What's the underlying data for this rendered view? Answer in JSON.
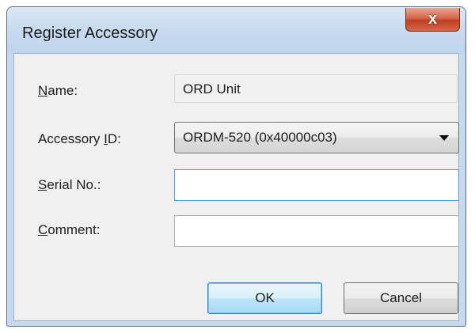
{
  "window": {
    "title": "Register Accessory",
    "close_glyph": "x"
  },
  "form": {
    "name": {
      "label_key": "N",
      "label_rest": "ame:",
      "value": "ORD Unit"
    },
    "accessory_id": {
      "label_pre": "Accessory ",
      "label_key": "I",
      "label_rest": "D:",
      "selected": "ORDM-520 (0x40000c03)"
    },
    "serial_no": {
      "label_key": "S",
      "label_rest": "erial No.:",
      "value": "",
      "placeholder": ""
    },
    "comment": {
      "label_key": "C",
      "label_rest": "omment:",
      "value": "",
      "placeholder": ""
    }
  },
  "buttons": {
    "ok": "OK",
    "cancel": "Cancel"
  },
  "icons": {
    "close": "close-icon",
    "dropdown": "chevron-down-icon"
  },
  "colors": {
    "title_bg": "#c9dcf0",
    "close_bg": "#c13d22",
    "client_bg": "#f0f0f0",
    "focus_border": "#569de5"
  }
}
